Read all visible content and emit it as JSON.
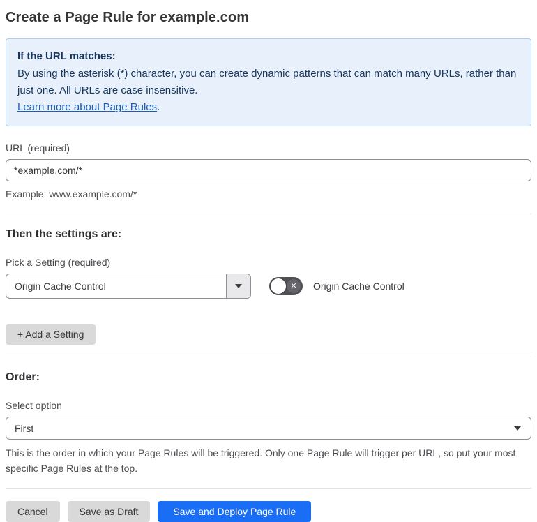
{
  "page": {
    "title": "Create a Page Rule for example.com"
  },
  "info_box": {
    "heading": "If the URL matches:",
    "body": "By using the asterisk (*) character, you can create dynamic patterns that can match many URLs, rather than just one. All URLs are case insensitive.",
    "link_label": "Learn more about Page Rules",
    "link_suffix": "."
  },
  "url_section": {
    "label": "URL (required)",
    "value": "*example.com/*",
    "helper": "Example: www.example.com/*"
  },
  "settings_section": {
    "heading": "Then the settings are:",
    "picker_label": "Pick a Setting (required)",
    "selected_setting": "Origin Cache Control",
    "toggle_label": "Origin Cache Control",
    "toggle_state": "off",
    "toggle_x_glyph": "✕",
    "add_button_label": "+ Add a Setting"
  },
  "order_section": {
    "heading": "Order:",
    "select_label": "Select option",
    "selected_option": "First",
    "helper": "This is the order in which your Page Rules will be triggered. Only one Page Rule will trigger per URL, so put your most specific Page Rules at the top."
  },
  "footer": {
    "cancel_label": "Cancel",
    "save_draft_label": "Save as Draft",
    "save_deploy_label": "Save and Deploy Page Rule"
  },
  "colors": {
    "info_background": "#e8f1fb",
    "info_border": "#aacdee",
    "info_text": "#16365e",
    "link": "#1d5cb5",
    "primary_button": "#1a6ef5",
    "gray_button": "#d9d9d9",
    "toggle_off": "#4f4f54"
  }
}
